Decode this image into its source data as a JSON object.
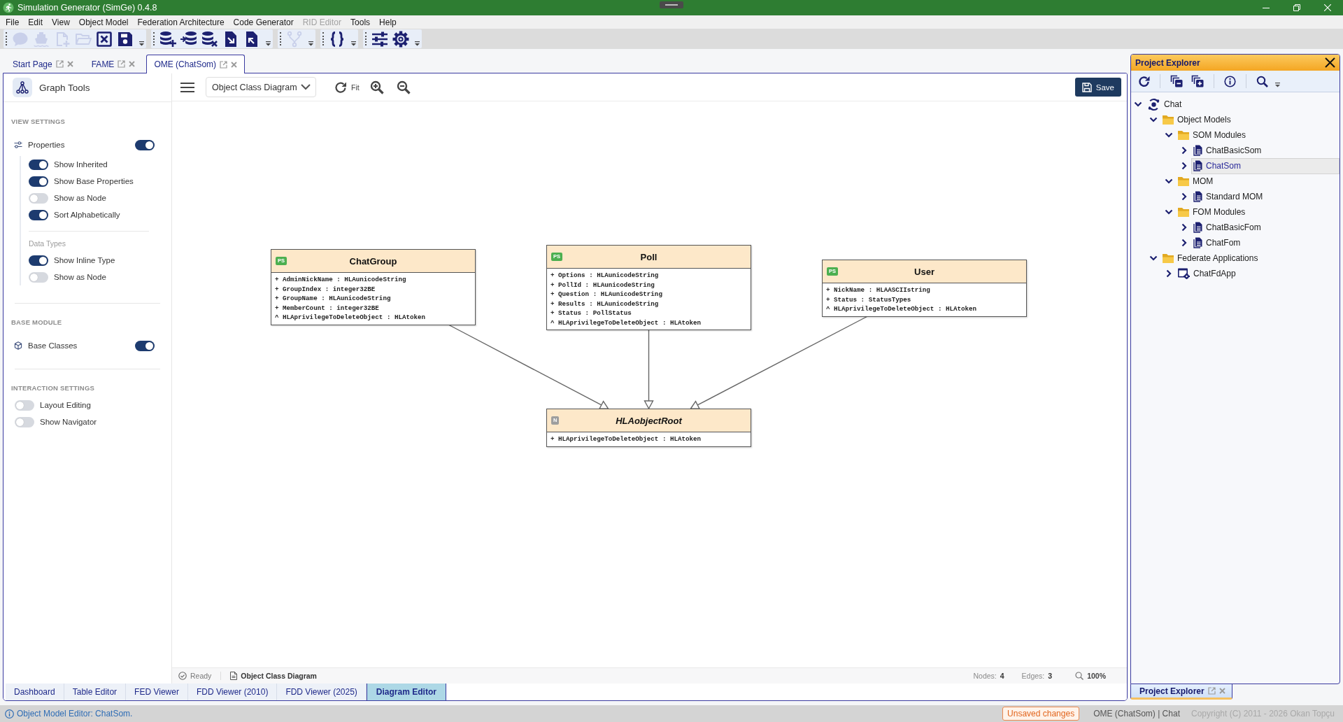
{
  "window": {
    "title": "Simulation Generator (SimGe) 0.4.8"
  },
  "menu": [
    {
      "label": "File",
      "disabled": false
    },
    {
      "label": "Edit",
      "disabled": false
    },
    {
      "label": "View",
      "disabled": false
    },
    {
      "label": "Object Model",
      "disabled": false
    },
    {
      "label": "Federation Architecture",
      "disabled": false
    },
    {
      "label": "Code Generator",
      "disabled": false
    },
    {
      "label": "RID Editor",
      "disabled": true
    },
    {
      "label": "Tools",
      "disabled": false
    },
    {
      "label": "Help",
      "disabled": false
    }
  ],
  "toolbar": [
    {
      "buttons": [
        {
          "disabled": true
        },
        {
          "disabled": true
        },
        {
          "disabled": true
        },
        {
          "disabled": true
        },
        {
          "disabled": false
        },
        {
          "disabled": false
        }
      ]
    },
    {
      "buttons": [
        {
          "disabled": false
        },
        {
          "disabled": false
        },
        {
          "disabled": false
        },
        {
          "disabled": false
        },
        {
          "disabled": false
        }
      ]
    },
    {
      "buttons": [
        {
          "disabled": true
        }
      ]
    },
    {
      "buttons": [
        {
          "disabled": false
        }
      ]
    },
    {
      "buttons": [
        {
          "disabled": false
        },
        {
          "disabled": false
        }
      ]
    }
  ],
  "document_tabs": [
    {
      "label": "Start Page",
      "selected": false
    },
    {
      "label": "FAME",
      "selected": false
    },
    {
      "label": "OME (ChatSom)",
      "selected": true
    }
  ],
  "graph_tools": {
    "title": "Graph Tools",
    "sections": [
      {
        "heading": "VIEW SETTINGS",
        "toggle": {
          "label": "Properties",
          "on": true
        },
        "options": [
          {
            "label": "Show Inherited",
            "on": true
          },
          {
            "label": "Show Base Properties",
            "on": true
          },
          {
            "label": "Show as Node",
            "on": false
          },
          {
            "label": "Sort Alphabetically",
            "on": true
          }
        ],
        "group": {
          "label": "Data Types",
          "options": [
            {
              "label": "Show Inline Type",
              "on": true
            },
            {
              "label": "Show as Node",
              "on": false
            }
          ]
        }
      },
      {
        "heading": "BASE MODULE",
        "toggle": {
          "label": "Base Classes",
          "on": true
        }
      },
      {
        "heading": "INTERACTION SETTINGS",
        "options": [
          {
            "label": "Layout Editing",
            "on": false
          },
          {
            "label": "Show Navigator",
            "on": false
          }
        ]
      }
    ]
  },
  "diagram": {
    "view_selector": "Object Class Diagram",
    "fit_label": "Fit",
    "save_label": "Save",
    "classes": [
      {
        "name": "HLAobjectRoot",
        "badge": "N",
        "color": "#9e9e9e",
        "abstract": true,
        "attributes": [
          "+ HLAprivilegeToDeleteObject : HLAtoken"
        ],
        "subclasses": [
          {
            "name": "ChatGroup",
            "badge": "PS",
            "color": "#4caf50",
            "abstract": false,
            "attributes": [
              "+ AdminNickName : HLAunicodeString",
              "+ GroupIndex : integer32BE",
              "+ GroupName : HLAunicodeString",
              "+ MemberCount : integer32BE",
              "^ HLAprivilegeToDeleteObject : HLAtoken"
            ]
          },
          {
            "name": "Poll",
            "badge": "PS",
            "color": "#4caf50",
            "abstract": false,
            "attributes": [
              "+ Options : HLAunicodeString",
              "+ PollId : HLAunicodeString",
              "+ Question : HLAunicodeString",
              "+ Results : HLAunicodeString",
              "+ Status : PollStatus",
              "^ HLAprivilegeToDeleteObject : HLAtoken"
            ]
          },
          {
            "name": "User",
            "badge": "PS",
            "color": "#4caf50",
            "abstract": false,
            "attributes": [
              "+ NickName : HLAASCIIstring",
              "+ Status : StatusTypes",
              "^ HLAprivilegeToDeleteObject : HLAtoken"
            ]
          }
        ]
      }
    ],
    "status": {
      "state": "Ready",
      "view": "Object Class Diagram",
      "nodes_label": "Nodes:",
      "nodes": "4",
      "edges_label": "Edges:",
      "edges": "3",
      "zoom": "100%"
    }
  },
  "editor_tabs": [
    {
      "label": "Dashboard",
      "selected": false
    },
    {
      "label": "Table Editor",
      "selected": false
    },
    {
      "label": "FED Viewer",
      "selected": false
    },
    {
      "label": "FDD Viewer (2010)",
      "selected": false
    },
    {
      "label": "FDD Viewer (2025)",
      "selected": false
    },
    {
      "label": "Diagram Editor",
      "selected": true
    }
  ],
  "project_explorer": {
    "title": "Project Explorer",
    "tree": [
      {
        "label": "Chat",
        "kind": "project",
        "expanded": true,
        "selected": false,
        "children": [
          {
            "label": "Object Models",
            "kind": "folder",
            "expanded": true,
            "selected": false,
            "children": [
              {
                "label": "SOM Modules",
                "kind": "folder",
                "expanded": true,
                "selected": false,
                "children": [
                  {
                    "label": "ChatBasicSom",
                    "kind": "document",
                    "expanded": false,
                    "selected": false
                  },
                  {
                    "label": "ChatSom",
                    "kind": "document",
                    "expanded": false,
                    "selected": true
                  }
                ]
              },
              {
                "label": "MOM",
                "kind": "folder",
                "expanded": true,
                "selected": false,
                "children": [
                  {
                    "label": "Standard MOM",
                    "kind": "document",
                    "expanded": false,
                    "selected": false
                  }
                ]
              },
              {
                "label": "FOM Modules",
                "kind": "folder",
                "expanded": true,
                "selected": false,
                "children": [
                  {
                    "label": "ChatBasicFom",
                    "kind": "document",
                    "expanded": false,
                    "selected": false
                  },
                  {
                    "label": "ChatFom",
                    "kind": "document",
                    "expanded": false,
                    "selected": false
                  }
                ]
              }
            ]
          },
          {
            "label": "Federate Applications",
            "kind": "folder",
            "expanded": true,
            "selected": false,
            "children": [
              {
                "label": "ChatFdApp",
                "kind": "application",
                "expanded": false,
                "selected": false
              }
            ]
          }
        ]
      }
    ],
    "tab_label": "Project Explorer"
  },
  "status_bar": {
    "message": "Object Model Editor: ChatSom.",
    "badge": "Unsaved changes",
    "context": "OME (ChatSom) | Chat",
    "copyright": "Copyright (C) 2011 - 2026 Okan Topçu"
  }
}
